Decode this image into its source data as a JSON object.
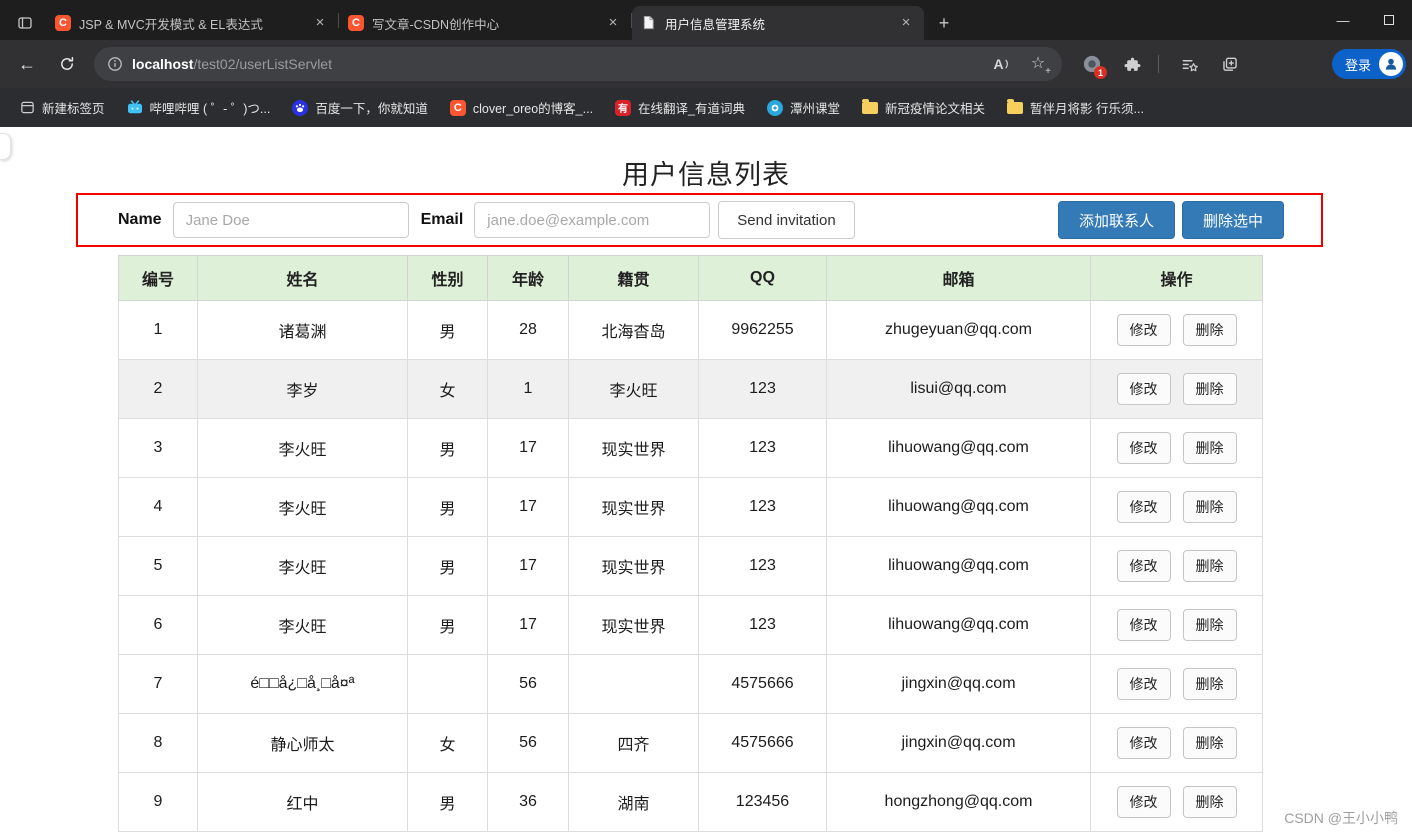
{
  "browser": {
    "tabs": [
      {
        "title": "JSP & MVC开发模式 & EL表达式"
      },
      {
        "title": "写文章-CSDN创作中心"
      },
      {
        "title": "用户信息管理系统"
      }
    ],
    "url": {
      "host": "localhost",
      "path": "/test02/userListServlet"
    },
    "notification_badge": "1",
    "login_label": "登录",
    "bookmarks": [
      {
        "label": "新建标签页"
      },
      {
        "label": "哔哩哔哩 ( ゜- ゜)つ..."
      },
      {
        "label": "百度一下，你就知道"
      },
      {
        "label": "clover_oreo的博客_..."
      },
      {
        "label": "在线翻译_有道词典"
      },
      {
        "label": "潭州课堂"
      },
      {
        "label": "新冠疫情论文相关"
      },
      {
        "label": "暂伴月将影 行乐须..."
      }
    ]
  },
  "glyphs": {
    "back": "←",
    "close": "×",
    "plus": "+",
    "minimize": "—",
    "star": "☆",
    "star_plus": "+",
    "read_aloud": "A",
    "csdn_letter": "C",
    "youdao_letter": "有"
  },
  "page": {
    "title": "用户信息列表",
    "form": {
      "name_label": "Name",
      "name_placeholder": "Jane Doe",
      "email_label": "Email",
      "email_placeholder": "jane.doe@example.com",
      "send_button": "Send invitation",
      "add_button": "添加联系人",
      "delete_button": "删除选中"
    },
    "table": {
      "headers": [
        "编号",
        "姓名",
        "性别",
        "年龄",
        "籍贯",
        "QQ",
        "邮箱",
        "操作"
      ],
      "edit_label": "修改",
      "delete_label": "删除",
      "rows": [
        {
          "id": "1",
          "name": "诸葛渊",
          "gender": "男",
          "age": "28",
          "origin": "北海杳岛",
          "qq": "9962255",
          "email": "zhugeyuan@qq.com",
          "shaded": false
        },
        {
          "id": "2",
          "name": "李岁",
          "gender": "女",
          "age": "1",
          "origin": "李火旺",
          "qq": "123",
          "email": "lisui@qq.com",
          "shaded": true
        },
        {
          "id": "3",
          "name": "李火旺",
          "gender": "男",
          "age": "17",
          "origin": "现实世界",
          "qq": "123",
          "email": "lihuowang@qq.com",
          "shaded": false
        },
        {
          "id": "4",
          "name": "李火旺",
          "gender": "男",
          "age": "17",
          "origin": "现实世界",
          "qq": "123",
          "email": "lihuowang@qq.com",
          "shaded": false
        },
        {
          "id": "5",
          "name": "李火旺",
          "gender": "男",
          "age": "17",
          "origin": "现实世界",
          "qq": "123",
          "email": "lihuowang@qq.com",
          "shaded": false
        },
        {
          "id": "6",
          "name": "李火旺",
          "gender": "男",
          "age": "17",
          "origin": "现实世界",
          "qq": "123",
          "email": "lihuowang@qq.com",
          "shaded": false
        },
        {
          "id": "7",
          "name": "é□□å¿□å¸□å¤ª",
          "gender": "",
          "age": "56",
          "origin": "",
          "qq": "4575666",
          "email": "jingxin@qq.com",
          "shaded": false
        },
        {
          "id": "8",
          "name": "静心师太",
          "gender": "女",
          "age": "56",
          "origin": "四齐",
          "qq": "4575666",
          "email": "jingxin@qq.com",
          "shaded": false
        },
        {
          "id": "9",
          "name": "红中",
          "gender": "男",
          "age": "36",
          "origin": "湖南",
          "qq": "123456",
          "email": "hongzhong@qq.com",
          "shaded": false
        }
      ]
    },
    "watermark": "CSDN @王小小鸭"
  },
  "colors": {
    "annotation_red": "#f20000",
    "primary_blue": "#337ab7",
    "table_header_green": "#dff0d8",
    "csdn_orange": "#fc5531",
    "signin_blue": "#0d62c9",
    "badge_red": "#d93025"
  }
}
